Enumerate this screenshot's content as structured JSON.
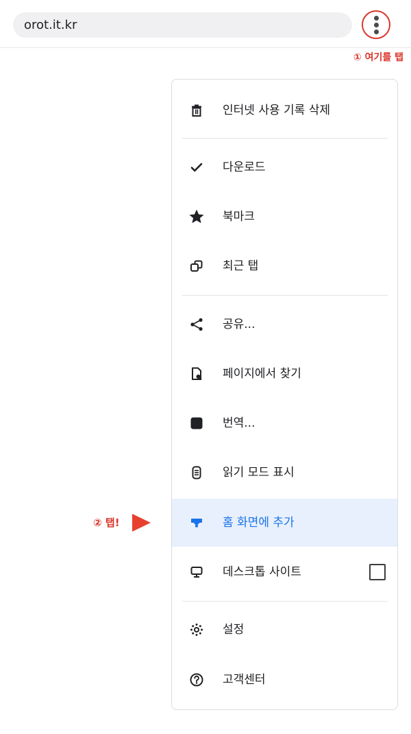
{
  "address_bar": {
    "url": "orot.it.kr"
  },
  "callouts": {
    "step1": "① 여기를 탭",
    "step2": "② 탭!"
  },
  "colors": {
    "accent": "#1a73e8",
    "highlight_bg": "#e8f0fe",
    "callout": "#d9362b"
  },
  "menu": {
    "items": [
      {
        "label": "인터넷 사용 기록 삭제",
        "icon": "trash-icon"
      },
      {
        "label": "다운로드",
        "icon": "check-icon"
      },
      {
        "label": "북마크",
        "icon": "star-icon"
      },
      {
        "label": "최근 탭",
        "icon": "recent-tabs-icon"
      },
      {
        "label": "공유...",
        "icon": "share-icon"
      },
      {
        "label": "페이지에서 찾기",
        "icon": "find-in-page-icon"
      },
      {
        "label": "번역...",
        "icon": "translate-icon"
      },
      {
        "label": "읽기 모드 표시",
        "icon": "reader-mode-icon"
      },
      {
        "label": "홈 화면에 추가",
        "icon": "add-to-home-icon",
        "highlighted": true
      },
      {
        "label": "데스크톱 사이트",
        "icon": "desktop-icon",
        "checkbox": false
      },
      {
        "label": "설정",
        "icon": "gear-icon"
      },
      {
        "label": "고객센터",
        "icon": "help-icon"
      }
    ]
  }
}
